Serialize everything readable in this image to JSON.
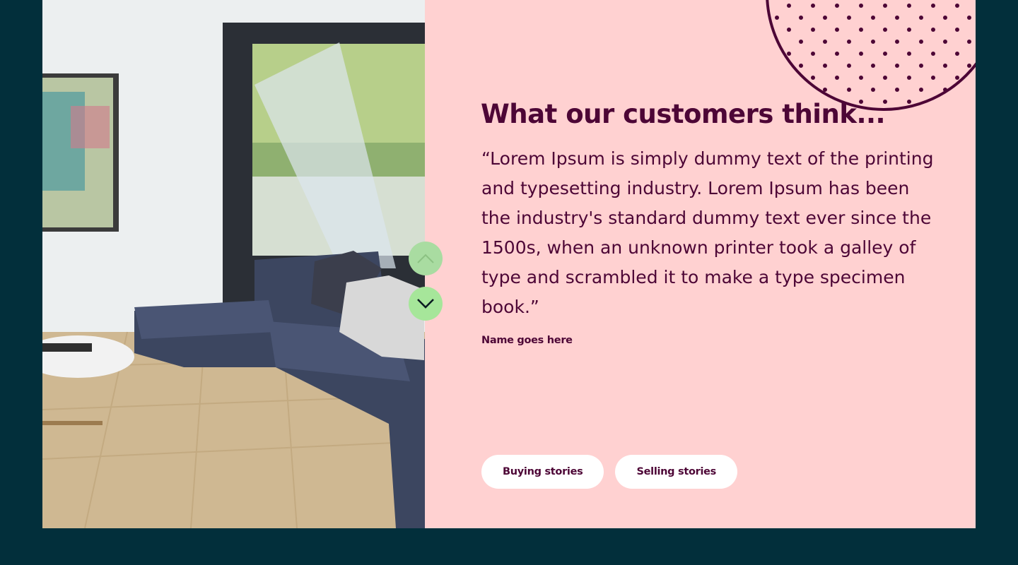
{
  "testimonial": {
    "heading": "What our customers think...",
    "quote": "“Lorem Ipsum is simply dummy text of the printing and typesetting industry. Lorem Ipsum has been the industry's standard dummy text ever since the 1500s, when an unknown printer took a galley of type and scrambled it to make a type specimen book.”",
    "author": "Name goes here"
  },
  "tabs": [
    {
      "label": "Buying stories"
    },
    {
      "label": "Selling stories"
    }
  ],
  "carousel": {
    "prev_icon": "chevron-up-icon",
    "next_icon": "chevron-down-icon"
  },
  "colors": {
    "page_bg": "#022f3b",
    "panel_bg": "#ffd1d1",
    "text": "#4d0636",
    "arrow_bg": "#a6e69a",
    "pill_bg": "#ffffff"
  },
  "image": {
    "subject": "living-room-photo"
  }
}
